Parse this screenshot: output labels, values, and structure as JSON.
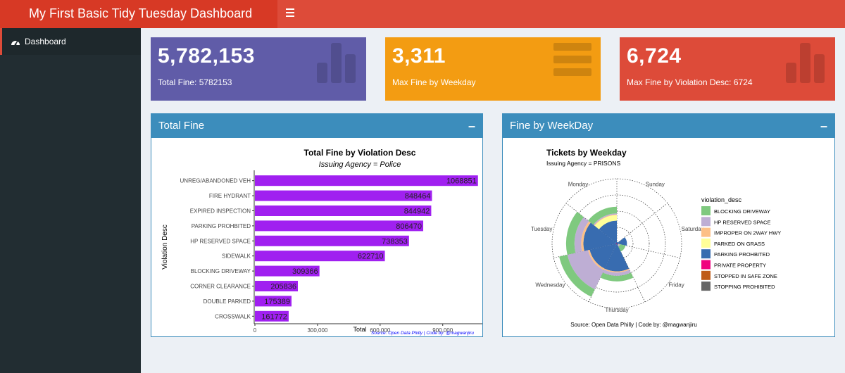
{
  "header": {
    "title": "My First Basic Tidy Tuesday Dashboard"
  },
  "sidebar": {
    "items": [
      {
        "label": "Dashboard",
        "icon": "dashboard-icon"
      }
    ]
  },
  "value_boxes": [
    {
      "value": "5,782,153",
      "subtitle": "Total Fine: 5782153",
      "color": "#605ca8",
      "icon": "bar-chart-icon"
    },
    {
      "value": "3,311",
      "subtitle": "Max Fine by Weekday",
      "color": "#f39c12",
      "icon": "list-icon"
    },
    {
      "value": "6,724",
      "subtitle": "Max Fine by Violation Desc: 6724",
      "color": "#dd4b39",
      "icon": "bar-chart-icon"
    }
  ],
  "panels": {
    "total_fine": {
      "title": "Total Fine"
    },
    "weekday": {
      "title": "Fine by WeekDay"
    }
  },
  "chart_data": [
    {
      "type": "bar",
      "orientation": "horizontal",
      "title": "Total Fine by Violation Desc",
      "subtitle": "Issuing Agency = Police",
      "xlabel": "Total",
      "ylabel": "Violation Desc",
      "categories": [
        "UNREG/ABANDONED VEH",
        "FIRE HYDRANT",
        "EXPIRED INSPECTION",
        "PARKING PROHBITED",
        "HP RESERVED SPACE",
        "SIDEWALK",
        "BLOCKING DRIVEWAY",
        "CORNER CLEARANCE",
        "DOUBLE PARKED",
        "CROSSWALK"
      ],
      "values": [
        1068851,
        848464,
        844942,
        806470,
        738353,
        622710,
        309366,
        205836,
        175389,
        161772
      ],
      "xticks": [
        0,
        300000,
        600000,
        900000
      ],
      "xtick_labels": [
        "0",
        "300,000",
        "600,000",
        "900,000"
      ],
      "xlim": [
        0,
        1100000
      ],
      "bar_color": "#a020f0",
      "caption": "Source: Open Data Philly | Code by: @magwanjiru",
      "caption_color": "#0000ff"
    },
    {
      "type": "polar_stacked_bar",
      "title": "Tickets by Weekday",
      "subtitle": "Issuing Agency = PRISONS",
      "legend_title": "violation_desc",
      "legend_position": "right",
      "categories": [
        "Sunday",
        "Saturday",
        "Friday",
        "Thursday",
        "Wednesday",
        "Tuesday",
        "Monday"
      ],
      "series": [
        {
          "name": "BLOCKING DRIVEWAY",
          "color": "#7fc97f",
          "values": [
            0,
            0,
            10,
            10,
            15,
            15,
            12
          ]
        },
        {
          "name": "HP RESERVED SPACE",
          "color": "#beaed4",
          "values": [
            0,
            0,
            2,
            6,
            38,
            12,
            2
          ]
        },
        {
          "name": "IMPROPER ON 2WAY HWY",
          "color": "#fdc086",
          "values": [
            0,
            0,
            1,
            2,
            3,
            4,
            1
          ]
        },
        {
          "name": "PARKED ON GRASS",
          "color": "#ffff99",
          "values": [
            0,
            0,
            0,
            0,
            0,
            0,
            10
          ]
        },
        {
          "name": "PARKING PROHBITED",
          "color": "#386cb0",
          "values": [
            3,
            18,
            3,
            50,
            48,
            60,
            40
          ]
        },
        {
          "name": "PRIVATE PROPERTY",
          "color": "#f0027f",
          "values": [
            0,
            0,
            0,
            0,
            2,
            0,
            1
          ]
        },
        {
          "name": "STOPPED IN SAFE ZONE",
          "color": "#bf5b17",
          "values": [
            0,
            0,
            0,
            0,
            0,
            0,
            0
          ]
        },
        {
          "name": "STOPPING PROHIBITED",
          "color": "#666666",
          "values": [
            0,
            0,
            0,
            0,
            0,
            0,
            0
          ]
        }
      ],
      "grid": true,
      "caption": "Source: Open Data Philly | Code by: @magwanjiru"
    }
  ]
}
